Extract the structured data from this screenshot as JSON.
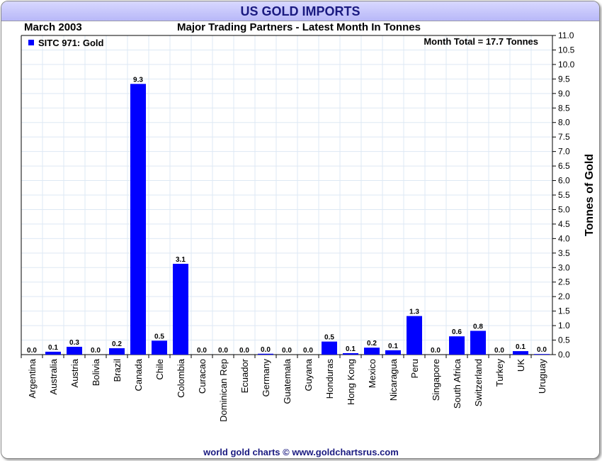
{
  "title": "US GOLD IMPORTS",
  "date_label": "March 2003",
  "subtitle": "Major Trading Partners - Latest Month In Tonnes",
  "footer": "world gold charts © www.goldchartsrus.com",
  "chart_data": {
    "type": "bar",
    "title": "US GOLD IMPORTS",
    "ylabel": "Tonnes of Gold",
    "ylim": [
      0,
      11
    ],
    "ytick_step": 0.5,
    "grid": true,
    "legend": {
      "label": "SITC 971: Gold",
      "placement": "top-left"
    },
    "annotation": "Month Total = 17.7 Tonnes",
    "color": "#0000ff",
    "categories": [
      "Argentina",
      "Australia",
      "Austria",
      "Bolivia",
      "Brazil",
      "Canada",
      "Chile",
      "Colombia",
      "Curacao",
      "Dominican Rep",
      "Ecuador",
      "Germany",
      "Guatemala",
      "Guyana",
      "Honduras",
      "Hong Kong",
      "Mexico",
      "Nicaragua",
      "Peru",
      "Singapore",
      "South Africa",
      "Switzerland",
      "Turkey",
      "UK",
      "Uruguay"
    ],
    "values": [
      0.0,
      0.1,
      0.27,
      0.0,
      0.22,
      9.33,
      0.48,
      3.13,
      0.0,
      0.0,
      0.0,
      0.03,
      0.0,
      0.0,
      0.45,
      0.05,
      0.24,
      0.15,
      1.33,
      0.0,
      0.63,
      0.82,
      0.0,
      0.12,
      0.02
    ],
    "labels": [
      "0.0",
      "0.1",
      "0.3",
      "0.0",
      "0.2",
      "9.3",
      "0.5",
      "3.1",
      "0.0",
      "0.0",
      "0.0",
      "0.0",
      "0.0",
      "0.0",
      "0.5",
      "0.1",
      "0.2",
      "0.1",
      "1.3",
      "0.0",
      "0.6",
      "0.8",
      "0.0",
      "0.1",
      "0.0"
    ]
  }
}
